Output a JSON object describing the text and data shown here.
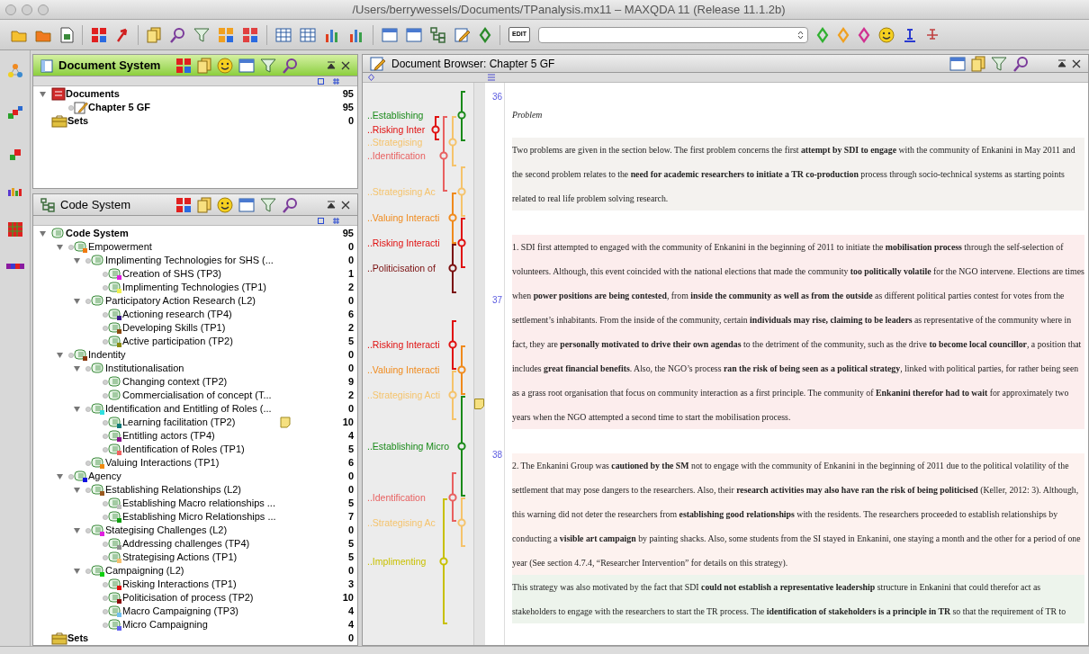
{
  "window": {
    "title": "/Users/berrywessels/Documents/TPanalysis.mx11 – MAXQDA 11 (Release 11.1.2b)"
  },
  "toolbar": {
    "edit_label": "EDIT"
  },
  "document_system": {
    "title": "Document System",
    "active": true,
    "items": [
      {
        "kind": "documents",
        "label": "Documents",
        "count": "95",
        "expanded": true,
        "children": [
          {
            "kind": "document",
            "label": "Chapter 5 GF",
            "count": "95"
          }
        ]
      },
      {
        "kind": "sets",
        "label": "Sets",
        "count": "0"
      }
    ]
  },
  "code_system": {
    "title": "Code System",
    "active": false,
    "items": [
      {
        "kind": "root",
        "label": "Code System",
        "count": "95",
        "expanded": true,
        "children": [
          {
            "kind": "code",
            "label": "Empowerment",
            "count": "0",
            "color": "#f07a10",
            "expanded": true,
            "children": [
              {
                "kind": "code",
                "label": "Implimenting Technologies for SHS (...",
                "count": "0",
                "expanded": true,
                "children": [
                  {
                    "kind": "code",
                    "label": "Creation of SHS (TP3)",
                    "count": "1",
                    "color": "#e020e0"
                  },
                  {
                    "kind": "code",
                    "label": "Implimenting Technologies (TP1)",
                    "count": "2",
                    "color": "#f0f050"
                  }
                ]
              },
              {
                "kind": "code",
                "label": "Participatory Action Research (L2)",
                "count": "0",
                "expanded": true,
                "children": [
                  {
                    "kind": "code",
                    "label": "Actioning research (TP4)",
                    "count": "6",
                    "color": "#3a1a8a"
                  },
                  {
                    "kind": "code",
                    "label": "Developing Skills (TP1)",
                    "count": "2",
                    "color": "#8a4a10"
                  },
                  {
                    "kind": "code",
                    "label": "Active participation (TP2)",
                    "count": "5",
                    "color": "#8a8a10"
                  }
                ]
              }
            ]
          },
          {
            "kind": "code",
            "label": "Indentity",
            "count": "0",
            "color": "#8a3a10",
            "expanded": true,
            "children": [
              {
                "kind": "code",
                "label": "Institutionalisation",
                "count": "0",
                "expanded": true,
                "children": [
                  {
                    "kind": "code",
                    "label": "Changing context (TP2)",
                    "count": "9"
                  },
                  {
                    "kind": "code",
                    "label": "Commercialisation of concept (T...",
                    "count": "2"
                  }
                ]
              },
              {
                "kind": "code",
                "label": "Identification and Entitling of Roles (...",
                "count": "0",
                "color": "#30e0e0",
                "expanded": true,
                "children": [
                  {
                    "kind": "code",
                    "label": "Learning facilitation (TP2)",
                    "count": "10",
                    "color": "#107a7a",
                    "memo": true
                  },
                  {
                    "kind": "code",
                    "label": "Entitling actors (TP4)",
                    "count": "4",
                    "color": "#8a108a"
                  },
                  {
                    "kind": "code",
                    "label": "Identification of Roles (TP1)",
                    "count": "5",
                    "color": "#f06060"
                  }
                ]
              },
              {
                "kind": "code",
                "label": "Valuing Interactions (TP1)",
                "count": "6",
                "color": "#f08a10"
              }
            ]
          },
          {
            "kind": "code",
            "label": "Agency",
            "count": "0",
            "color": "#1010e0",
            "expanded": true,
            "children": [
              {
                "kind": "code",
                "label": "Establishing Relationships (L2)",
                "count": "0",
                "color": "#9a5a20",
                "expanded": true,
                "children": [
                  {
                    "kind": "code",
                    "label": "Establishing Macro relationships ...",
                    "count": "5",
                    "color": "#c0c0c0"
                  },
                  {
                    "kind": "code",
                    "label": "Establishing Micro Relationships ...",
                    "count": "7",
                    "color": "#10a010"
                  }
                ]
              },
              {
                "kind": "code",
                "label": "Stategising Challenges (L2)",
                "count": "0",
                "color": "#e020e0",
                "expanded": true,
                "children": [
                  {
                    "kind": "code",
                    "label": "Addressing challenges (TP4)",
                    "count": "5",
                    "color": "#909090"
                  },
                  {
                    "kind": "code",
                    "label": "Strategising Actions (TP1)",
                    "count": "5",
                    "color": "#f5c070"
                  }
                ]
              },
              {
                "kind": "code",
                "label": "Campaigning (L2)",
                "count": "0",
                "color": "#10d010",
                "expanded": true,
                "children": [
                  {
                    "kind": "code",
                    "label": "Risking Interactions (TP1)",
                    "count": "3",
                    "color": "#e01010"
                  },
                  {
                    "kind": "code",
                    "label": "Politicisation of process (TP2)",
                    "count": "10",
                    "color": "#8a0a0a"
                  },
                  {
                    "kind": "code",
                    "label": "Macro Campaigning  (TP3)",
                    "count": "4",
                    "color": "#70c0f0"
                  },
                  {
                    "kind": "code",
                    "label": "Micro Campaigning",
                    "count": "4",
                    "color": "#6060f0"
                  }
                ]
              }
            ]
          }
        ]
      },
      {
        "kind": "sets",
        "label": "Sets",
        "count": "0"
      }
    ]
  },
  "document_browser": {
    "title": "Document Browser: Chapter 5 GF",
    "coding_stripes": [
      {
        "label": "..Establishing",
        "color": "#1a8a1a"
      },
      {
        "label": "..Risking Inter",
        "color": "#e01010"
      },
      {
        "label": "..Strategising",
        "color": "#f5c36b"
      },
      {
        "label": "..Identification",
        "color": "#e86060"
      },
      {
        "label": "..Strategising Ac",
        "color": "#f5c36b"
      },
      {
        "label": "..Valuing Interacti",
        "color": "#f08a1c"
      },
      {
        "label": "..Risking Interacti",
        "color": "#e01010"
      },
      {
        "label": "..Politicisation of",
        "color": "#7a1010"
      },
      {
        "label": "..Risking Interacti",
        "color": "#e01010"
      },
      {
        "label": "..Valuing Interacti",
        "color": "#f08a1c"
      },
      {
        "label": "..Strategising Acti",
        "color": "#f5c36b"
      },
      {
        "label": "..Establishing Micro",
        "color": "#1a8a1a"
      },
      {
        "label": "..Identification",
        "color": "#e86060"
      },
      {
        "label": "..Strategising Ac",
        "color": "#f5c36b"
      },
      {
        "label": "..Implimenting",
        "color": "#c8c000"
      }
    ],
    "line_numbers": [
      "36",
      "37",
      "38"
    ],
    "paragraphs": [
      {
        "kind": "heading",
        "text": "Problem"
      },
      {
        "kind": "para",
        "text": "Two problems are given in the section below. The first problem concerns the first **attempt by SDI to engage** with the community of Enkanini in May 2011 and the second problem relates to the **need for academic researchers to initiate a TR co-production** process through socio-technical systems as starting points related to real life problem solving research."
      },
      {
        "kind": "para",
        "text": "1. SDI first attempted to engaged with the community of Enkanini in the beginning of 2011 to initiate the **mobilisation process** through the self-selection of volunteers. Although, this event coincided with the national elections that made the community **too politically volatile** for the NGO intervene. Elections are times when **power positions are being contested**, from **inside the community as well as from the outside** as different political parties contest for votes from the settlement’s inhabitants. From the inside of the community, certain **individuals may rise, claiming to be leaders** as representative of the community where in fact, they are **personally motivated to drive their own agendas** to the detriment of the community, such as the drive **to become local councillor**, a position that includes **great financial benefits**. Also, the NGO’s process **ran the risk of being seen as a political strategy**, linked with political parties, for rather being seen as a grass root organisation that focus on community interaction as a first principle. The community of **Enkanini therefor had to wait** for approximately two years when the NGO attempted a second time to start the mobilisation process."
      },
      {
        "kind": "para",
        "text": "2. The Enkanini Group was **cautioned by the SM** not to engage with the community of Enkanini in the beginning of 2011 due to the political volatility of the settlement that may pose dangers to the researchers. Also, their **research activities may also have ran the risk of being politicised** (Keller, 2012: 3). Although, this warning did not deter the researchers from **establishing good relationships** with the residents. The researchers proceeded to establish relationships by conducting a **visible art campaign** by painting shacks. Also, some students from the SI stayed in Enkanini, one staying a month and the other for a period of one year (See section 4.7.4, “Researcher Intervention” for details on this strategy)."
      },
      {
        "kind": "para",
        "text": "This strategy was also motivated by the fact that SDI **could not establish a representative leadership** structure in Enkanini that could therefor act as stakeholders to engage with the researchers to start the TR process. The **identification of stakeholders is a principle in TR** so that the requirement of TR to"
      }
    ]
  }
}
